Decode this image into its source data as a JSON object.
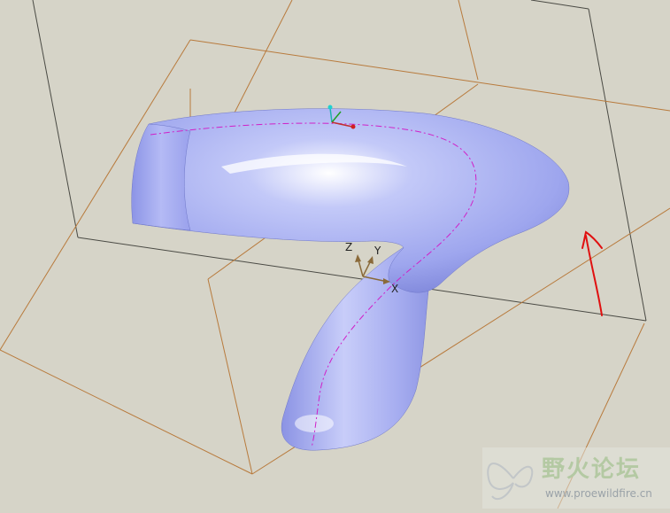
{
  "viewport": {
    "background": "#d6d4c8",
    "part_color": "#9ea6ee",
    "datum_plane_color": "#b87a3c",
    "sketch_curve_color": "#d020c8",
    "annotation_color": "#e01010"
  },
  "csys": {
    "z_label": "Z",
    "y_label": "Y",
    "origin_marker": "X"
  },
  "watermark": {
    "title": "野火论坛",
    "url": "www.proewildfire.cn"
  },
  "annotation": {
    "icon": "red-arrow-up"
  }
}
